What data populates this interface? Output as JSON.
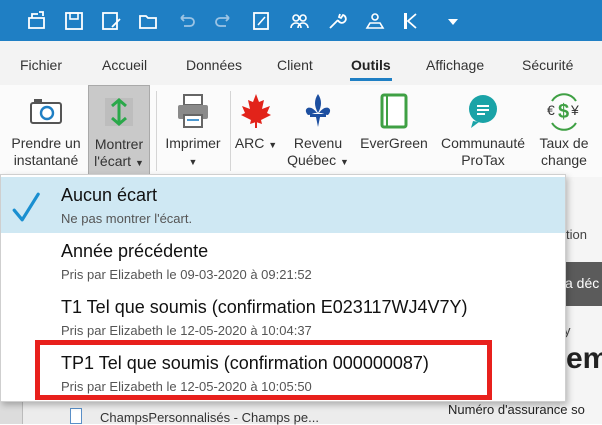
{
  "quick_access": {
    "icons": [
      "open-folder-icon",
      "save-icon",
      "save-as-icon",
      "folder-icon",
      "undo-icon",
      "redo-icon",
      "edit-form-icon",
      "users-icon",
      "wrench-icon",
      "tax-calculator-icon",
      "arrow-left-icon",
      "dropdown-arrow-icon"
    ]
  },
  "menu_tabs": [
    "Fichier",
    "Accueil",
    "Données",
    "Client",
    "Outils",
    "Affichage",
    "Sécurité"
  ],
  "active_tab": "Outils",
  "ribbon": {
    "buttons": [
      {
        "label": "Prendre un instantané",
        "line1": "Prendre un",
        "line2": "instantané"
      },
      {
        "label": "Montrer l'écart",
        "line1": "Montrer",
        "line2": "l'écart"
      },
      {
        "label": "Imprimer",
        "line1": "Imprimer",
        "line2": ""
      },
      {
        "label": "ARC",
        "line1": "ARC",
        "line2": ""
      },
      {
        "label": "Revenu Québec",
        "line1": "Revenu",
        "line2": "Québec"
      },
      {
        "label": "EverGreen",
        "line1": "EverGreen",
        "line2": ""
      },
      {
        "label": "Communauté ProTax",
        "line1": "Communauté",
        "line2": "ProTax"
      },
      {
        "label": "Taux de change",
        "line1": "Taux de",
        "line2": "change"
      }
    ]
  },
  "dropdown": {
    "items": [
      {
        "title": "Aucun écart",
        "subtitle": "Ne pas montrer l'écart.",
        "selected": true
      },
      {
        "title": "Année précédente",
        "subtitle": "Pris par Elizabeth le 09-03-2020 à 09:21:52",
        "selected": false
      },
      {
        "title": "T1 Tel que soumis (confirmation E023117WJ4V7Y)",
        "subtitle": "Pris par Elizabeth le 12-05-2020 à 10:04:37",
        "selected": false
      },
      {
        "title": "TP1 Tel que soumis (confirmation 000000087)",
        "subtitle": "Pris par Elizabeth le 12-05-2020 à 10:05:50",
        "selected": false
      }
    ]
  },
  "background": {
    "tab_fragment": "tion",
    "banner_fragment": "a déc",
    "heading_fragment": "em",
    "small_fragment": "y",
    "field_label": "Numéro d'assurance so",
    "tree_item": "ChampsPersonnalisés - Champs pe..."
  },
  "colors": {
    "title_bar": "#1f7fc4",
    "selected_row": "#cfe8f3",
    "checkmark": "#1a8fd0",
    "highlight_border": "#e8201c"
  }
}
